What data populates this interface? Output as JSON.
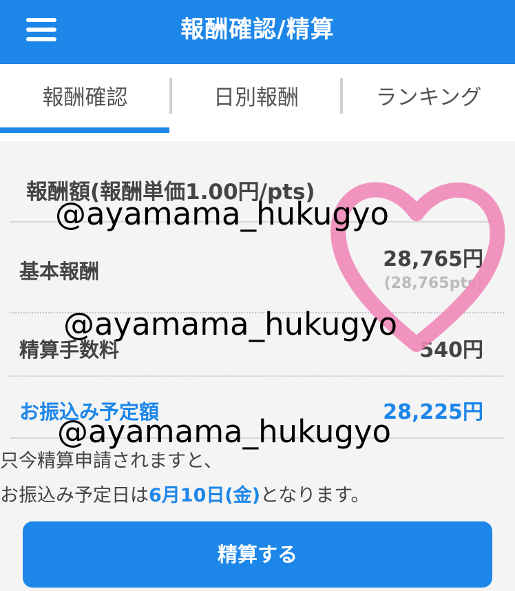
{
  "header": {
    "title": "報酬確認/精算"
  },
  "tabs": [
    {
      "label": "報酬確認"
    },
    {
      "label": "日別報酬"
    },
    {
      "label": "ランキング"
    }
  ],
  "summary": {
    "section_title": "報酬額(報酬単価1.00円/pts)",
    "rows": [
      {
        "label": "基本報酬",
        "value": "28,765円",
        "sub": "(28,765pts)"
      },
      {
        "label": "精算手数料",
        "value": "540円"
      },
      {
        "label": "お振込み予定額",
        "value": "28,225円"
      }
    ]
  },
  "notice": {
    "line1": "只今精算申請されますと、",
    "line2_prefix": "お振込み予定日は",
    "line2_date": "6月10日(金)",
    "line2_suffix": "となります。"
  },
  "submit_label": "精算する",
  "watermark": {
    "text1": "@ayamama_hukugyo",
    "text2": "@ayamama_hukugyo",
    "text3": "@ayamama_hukugyo"
  },
  "colors": {
    "accent": "#1d86e9",
    "heart": "#f08ab9"
  }
}
